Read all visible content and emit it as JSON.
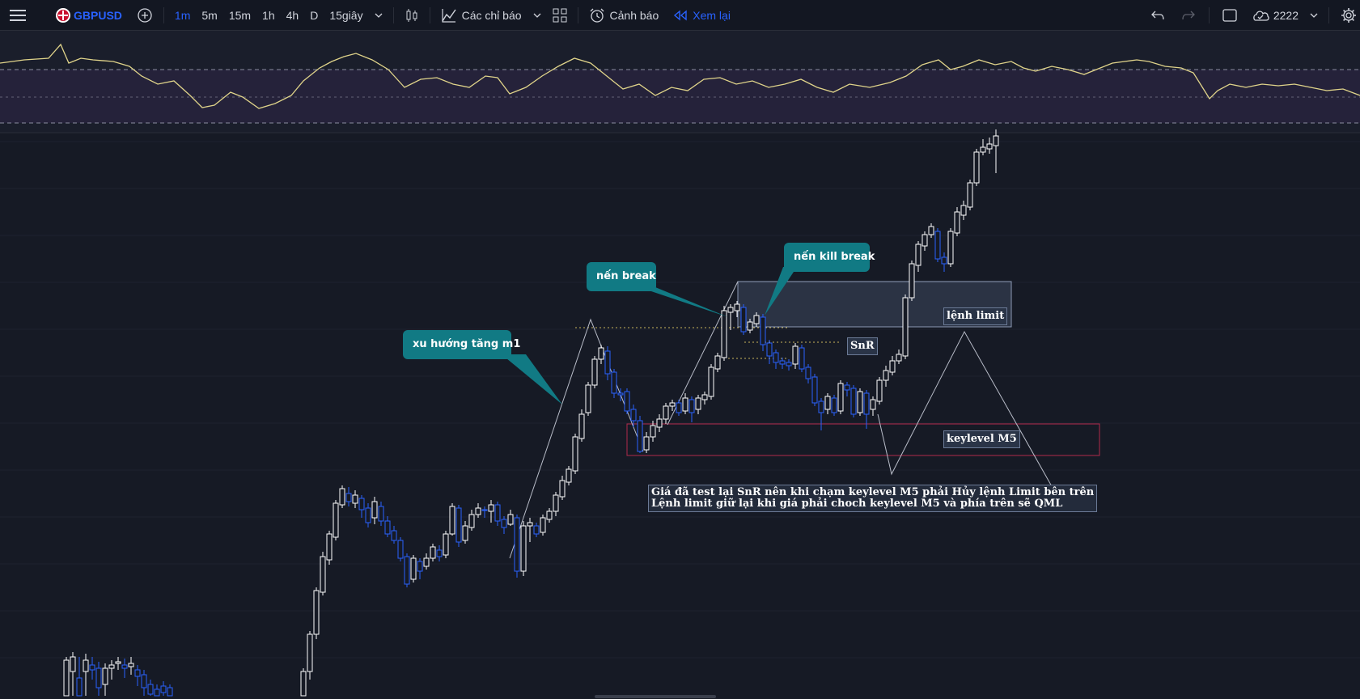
{
  "toolbar": {
    "symbol": "GBPUSD",
    "timeframes": [
      "1m",
      "5m",
      "15m",
      "1h",
      "4h",
      "D",
      "15giây"
    ],
    "active_timeframe": "1m",
    "indicators_label": "Các chỉ báo",
    "alerts_label": "Cảnh báo",
    "replay_label": "Xem lại",
    "cloud_label": "2222"
  },
  "annotations": {
    "callout_uptrend": "xu hướng tăng m1",
    "callout_break": "nến break",
    "callout_kill_break": "nến kill break",
    "label_snr": "SnR",
    "label_limit": "lệnh limit",
    "label_keylevel": "keylevel M5",
    "note_line1": "Giá đã test lại SnR nên khi chạm keylevel M5 phải Hủy lệnh Limit bên trên",
    "note_line2": "Lệnh limit giữ lại khi giá phải choch keylevel M5 và phía trên sẽ QML"
  },
  "colors": {
    "background": "#161a25",
    "toolbar": "#131722",
    "accent": "#2962ff",
    "bull_candle": "#ffffff",
    "bear_candle": "#2962ff",
    "rsi_line": "#e0d48a",
    "callout": "#117a84",
    "keylevel_border": "#b02a4a"
  }
}
